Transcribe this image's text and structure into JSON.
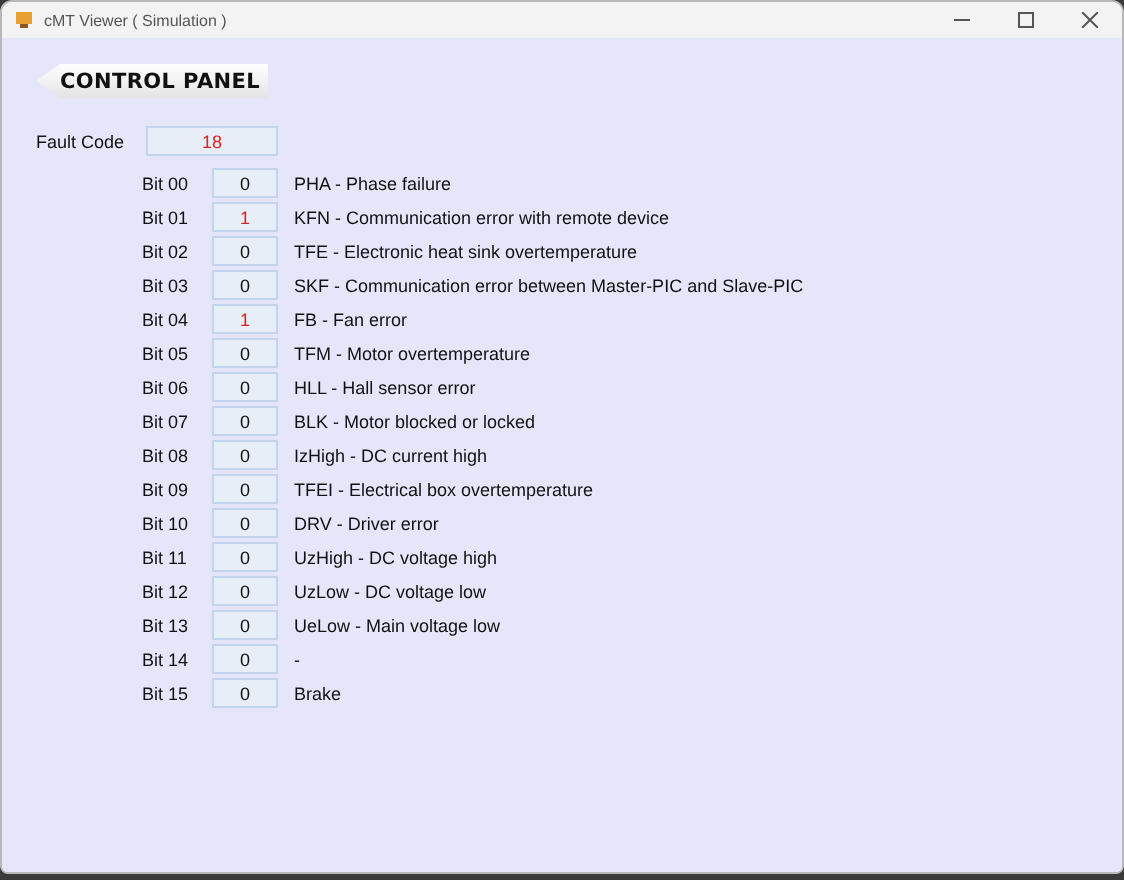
{
  "window": {
    "title": "cMT Viewer ( Simulation )"
  },
  "back_button": {
    "label": "CONTROL PANEL"
  },
  "fault_code": {
    "label": "Fault Code",
    "value": "18",
    "alert": true
  },
  "bits": [
    {
      "label": "Bit 00",
      "value": "0",
      "alert": false,
      "description": "PHA - Phase failure"
    },
    {
      "label": "Bit 01",
      "value": "1",
      "alert": true,
      "description": "KFN - Communication error with remote device"
    },
    {
      "label": "Bit 02",
      "value": "0",
      "alert": false,
      "description": "TFE - Electronic heat sink overtemperature"
    },
    {
      "label": "Bit 03",
      "value": "0",
      "alert": false,
      "description": "SKF - Communication error between Master-PIC and Slave-PIC"
    },
    {
      "label": "Bit 04",
      "value": "1",
      "alert": true,
      "description": "FB - Fan error"
    },
    {
      "label": "Bit 05",
      "value": "0",
      "alert": false,
      "description": "TFM - Motor overtemperature"
    },
    {
      "label": "Bit 06",
      "value": "0",
      "alert": false,
      "description": "HLL - Hall sensor error"
    },
    {
      "label": "Bit 07",
      "value": "0",
      "alert": false,
      "description": "BLK - Motor blocked or locked"
    },
    {
      "label": "Bit 08",
      "value": "0",
      "alert": false,
      "description": "IzHigh - DC current high"
    },
    {
      "label": "Bit 09",
      "value": "0",
      "alert": false,
      "description": "TFEI - Electrical box overtemperature"
    },
    {
      "label": "Bit 10",
      "value": "0",
      "alert": false,
      "description": "DRV - Driver error"
    },
    {
      "label": "Bit 11",
      "value": "0",
      "alert": false,
      "description": "UzHigh - DC voltage high"
    },
    {
      "label": "Bit 12",
      "value": "0",
      "alert": false,
      "description": "UzLow - DC voltage low"
    },
    {
      "label": "Bit 13",
      "value": "0",
      "alert": false,
      "description": "UeLow - Main voltage low"
    },
    {
      "label": "Bit 14",
      "value": "0",
      "alert": false,
      "description": "-"
    },
    {
      "label": "Bit 15",
      "value": "0",
      "alert": false,
      "description": "Brake"
    }
  ]
}
